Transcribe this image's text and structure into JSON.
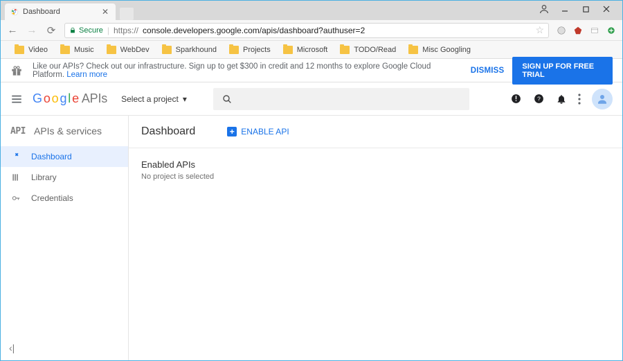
{
  "window": {
    "tab_title": "Dashboard"
  },
  "address": {
    "secure_label": "Secure",
    "url_scheme": "https://",
    "url_rest": "console.developers.google.com/apis/dashboard?authuser=2"
  },
  "bookmarks": [
    "Video",
    "Music",
    "WebDev",
    "Sparkhound",
    "Projects",
    "Microsoft",
    "TODO/Read",
    "Misc Googling"
  ],
  "promo": {
    "text": "Like our APIs? Check out our infrastructure. Sign up to get $300 in credit and 12 months to explore Google Cloud Platform. ",
    "link": "Learn more",
    "dismiss": "DISMISS",
    "trial": "SIGN UP FOR FREE TRIAL"
  },
  "header": {
    "logo_apis": "APIs",
    "project_selector": "Select a project"
  },
  "sidebar": {
    "section": "APIs & services",
    "items": [
      {
        "label": "Dashboard"
      },
      {
        "label": "Library"
      },
      {
        "label": "Credentials"
      }
    ]
  },
  "page": {
    "title": "Dashboard",
    "enable_api": "ENABLE API",
    "section_title": "Enabled APIs",
    "empty": "No project is selected"
  }
}
